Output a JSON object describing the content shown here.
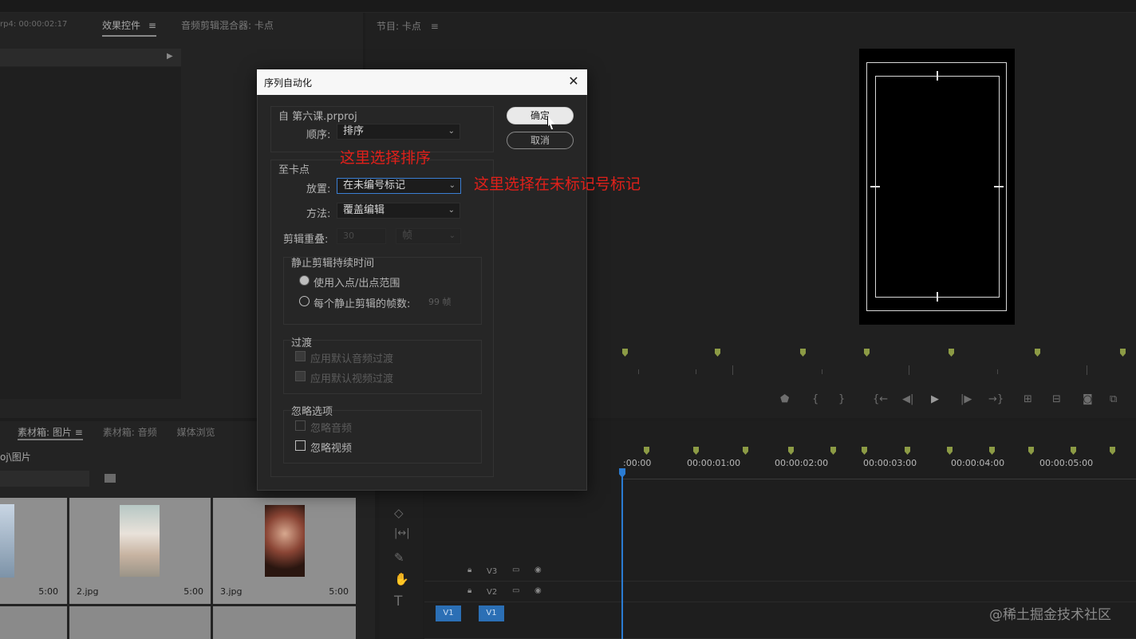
{
  "effects_panel": {
    "source_label": "rp4: 00:00:02:17",
    "tabs": [
      "效果控件",
      "音频剪辑混合器: 卡点"
    ],
    "tab_menu": "≡"
  },
  "program_panel": {
    "title": "节目: 卡点",
    "menu": "≡"
  },
  "project_panel": {
    "tabs": [
      "素材箱: 图片",
      "素材箱: 音频",
      "媒体浏览"
    ],
    "path": "oj\\图片",
    "items": [
      {
        "name": "",
        "duration": "5:00"
      },
      {
        "name": "2.jpg",
        "duration": "5:00"
      },
      {
        "name": "3.jpg",
        "duration": "5:00"
      }
    ]
  },
  "timeline": {
    "timecodes": [
      ":00:00",
      "00:00:01:00",
      "00:00:02:00",
      "00:00:03:00",
      "00:00:04:00",
      "00:00:05:00"
    ],
    "tracks": [
      {
        "name": "V3"
      },
      {
        "name": "V2"
      },
      {
        "name": "V1",
        "source": "V1"
      }
    ]
  },
  "dialog": {
    "title": "序列自动化",
    "from_label": "自 第六课.prproj",
    "order_label": "顺序:",
    "order_value": "排序",
    "to_label": "至卡点",
    "placement_label": "放置:",
    "placement_value": "在未编号标记",
    "method_label": "方法:",
    "method_value": "覆盖编辑",
    "clip_overlap_label": "剪辑重叠:",
    "clip_overlap_value": "30",
    "clip_overlap_unit": "帧",
    "still_group_label": "静止剪辑持续时间",
    "use_in_out": "使用入点/出点范围",
    "frames_per_still": "每个静止剪辑的帧数:",
    "frames_value": "99 帧",
    "transition_label": "过渡",
    "apply_audio": "应用默认音频过渡",
    "apply_video": "应用默认视频过渡",
    "ignore_label": "忽略选项",
    "ignore_audio": "忽略音频",
    "ignore_video": "忽略视频",
    "ok_label": "确定",
    "cancel_label": "取消",
    "close_glyph": "✕"
  },
  "annotations": {
    "order_note": "这里选择排序",
    "placement_note": "这里选择在未标记号标记",
    "color": "#e0201a"
  },
  "watermark": "@稀土掘金技术社区"
}
